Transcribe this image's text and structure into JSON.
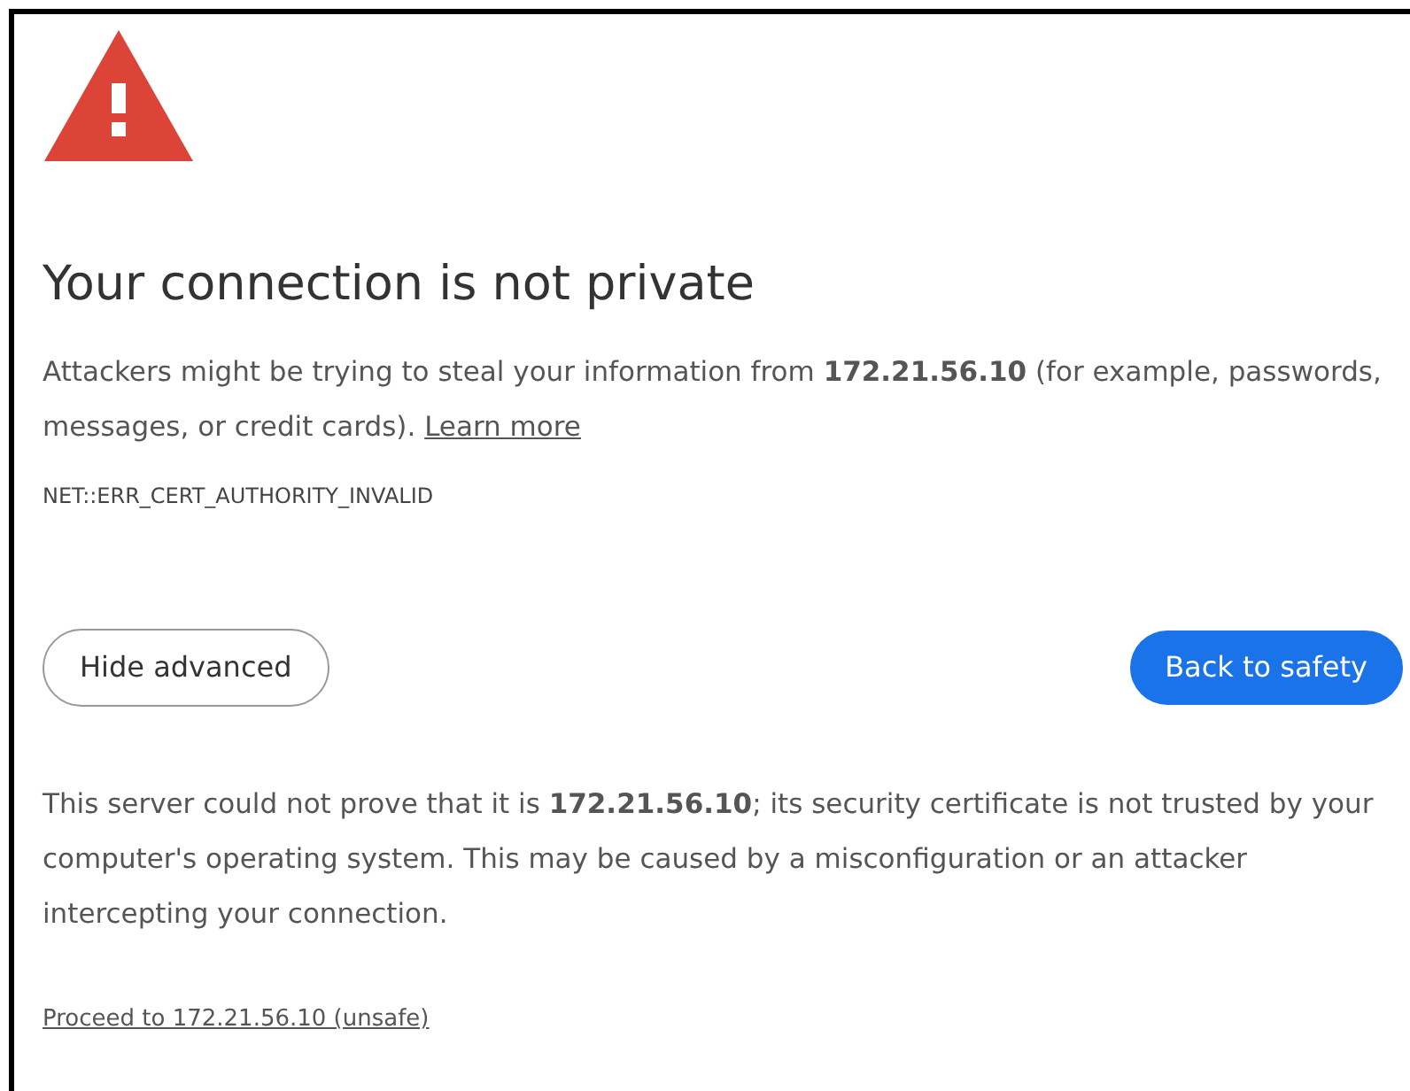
{
  "heading": "Your connection is not private",
  "message": "Attackers might be trying to steal your information from **172.21.56.10** (for example, passwords, messages, or credit cards).",
  "learn_more": "Learn more",
  "error_code": "NET::ERR_CERT_AUTHORITY_INVALID",
  "buttons": [
    {
      "label": "Hide advanced",
      "kind": "secondary"
    },
    {
      "label": "Back to safety",
      "kind": "primary"
    }
  ],
  "details": "This server could not prove that it is **172.21.56.10**; its security certificate is not trusted by your computer's operating system. This may be caused by a misconfiguration or an attacker intercepting your connection.",
  "proceed_link": "Proceed to 172.21.56.10 (unsafe)"
}
